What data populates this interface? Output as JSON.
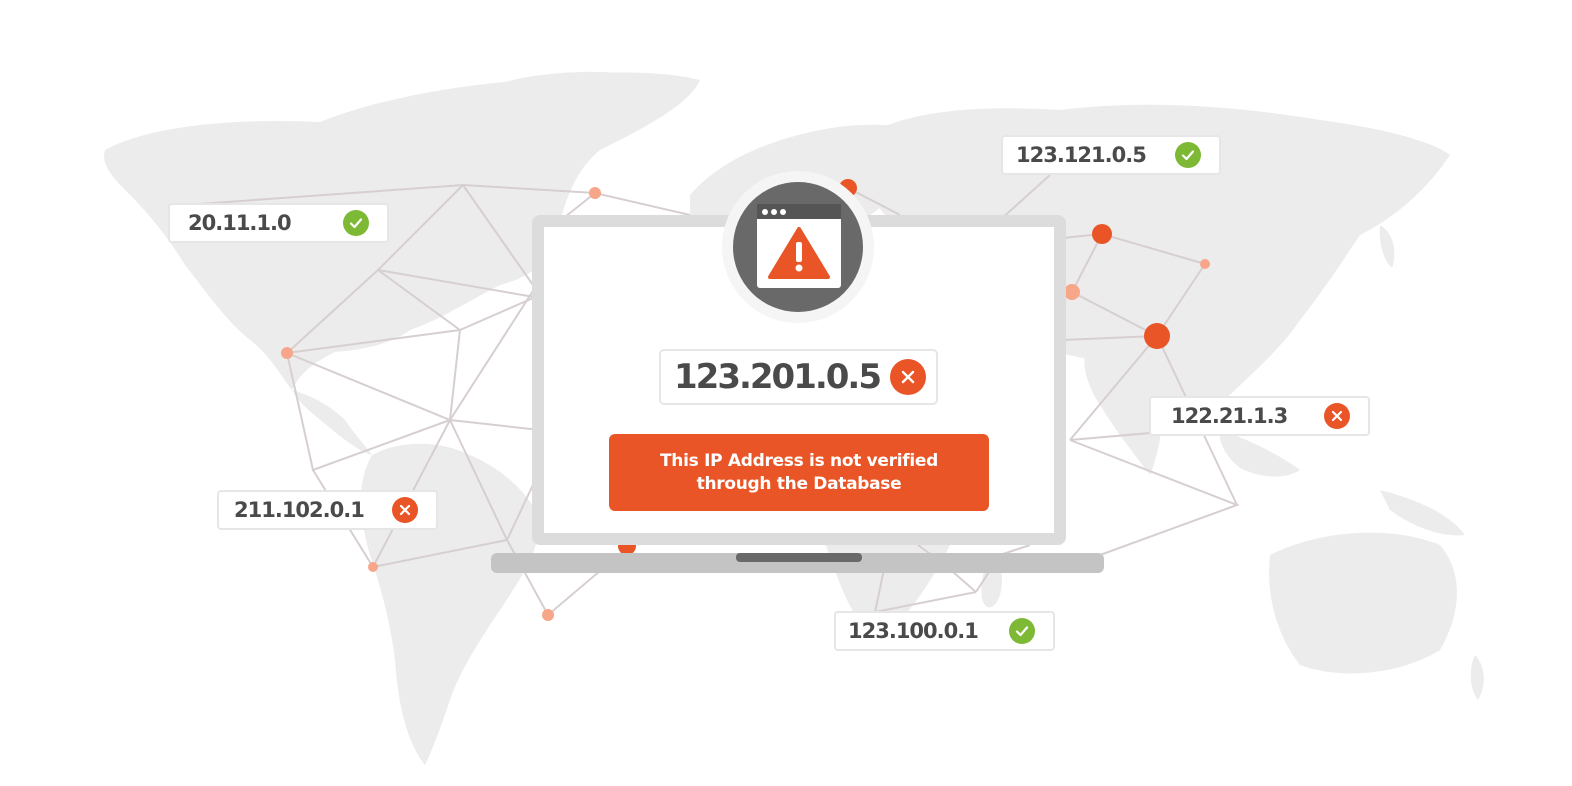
{
  "colors": {
    "accent": "#e95526",
    "accent_light": "#f7a68a",
    "success": "#7db935",
    "map": "#ececec",
    "network_line": "#d7cfcf",
    "laptop_frame": "#dcdcdc",
    "laptop_base": "#c4c4c4",
    "badge_bg": "#6a6969"
  },
  "main": {
    "ip_address": "123.201.0.5",
    "status": "invalid",
    "status_icon": "close-icon",
    "badge_icon": "warning-icon",
    "alert": {
      "line1": "This IP Address is not verified",
      "line2": "through the Database"
    }
  },
  "ip_cards": [
    {
      "ip": "20.11.1.0",
      "status": "valid",
      "icon": "check-icon"
    },
    {
      "ip": "123.121.0.5",
      "status": "valid",
      "icon": "check-icon"
    },
    {
      "ip": "122.21.1.3",
      "status": "invalid",
      "icon": "close-icon"
    },
    {
      "ip": "211.102.0.1",
      "status": "invalid",
      "icon": "close-icon"
    },
    {
      "ip": "123.100.0.1",
      "status": "valid",
      "icon": "check-icon"
    }
  ]
}
